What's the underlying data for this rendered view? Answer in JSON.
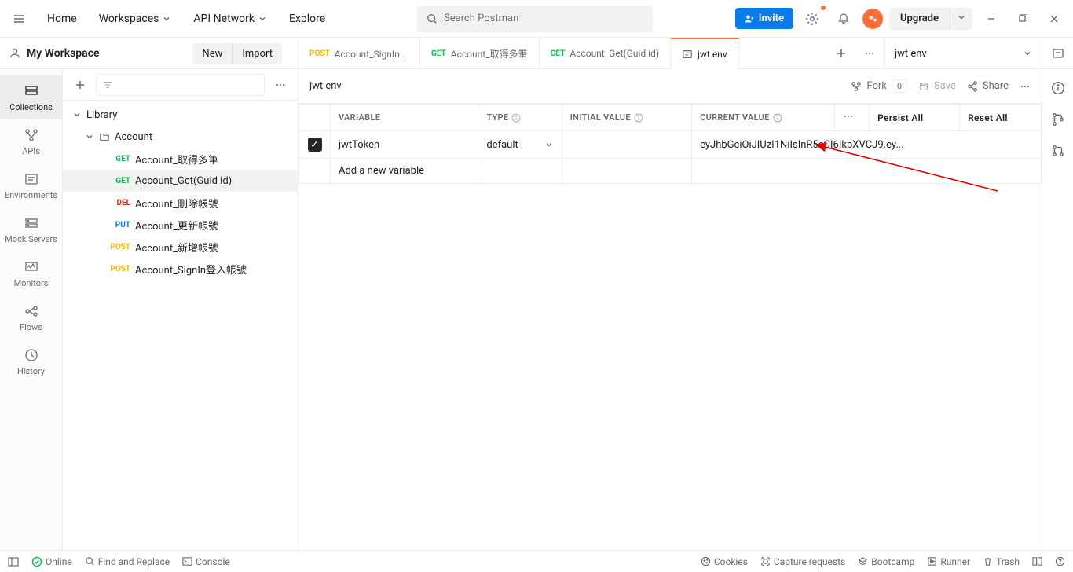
{
  "topbar": {
    "nav": {
      "home": "Home",
      "workspaces": "Workspaces",
      "api_network": "API Network",
      "explore": "Explore"
    },
    "search_placeholder": "Search Postman",
    "invite": "Invite",
    "upgrade": "Upgrade"
  },
  "workspace": {
    "name": "My Workspace",
    "new": "New",
    "import": "Import"
  },
  "rail": {
    "collections": "Collections",
    "apis": "APIs",
    "environments": "Environments",
    "mock_servers": "Mock Servers",
    "monitors": "Monitors",
    "flows": "Flows",
    "history": "History"
  },
  "tree": {
    "library": "Library",
    "account": "Account",
    "items": [
      {
        "method": "GET",
        "methodClass": "get",
        "label": "Account_取得多筆"
      },
      {
        "method": "GET",
        "methodClass": "get",
        "label": "Account_Get(Guid id)",
        "active": true
      },
      {
        "method": "DEL",
        "methodClass": "del",
        "label": "Account_刪除帳號"
      },
      {
        "method": "PUT",
        "methodClass": "put",
        "label": "Account_更新帳號"
      },
      {
        "method": "POST",
        "methodClass": "post",
        "label": "Account_新增帳號"
      },
      {
        "method": "POST",
        "methodClass": "post",
        "label": "Account_SignIn登入帳號"
      }
    ]
  },
  "tabs": [
    {
      "method": "POST",
      "methodClass": "post",
      "label": "Account_SignIn登入帳"
    },
    {
      "method": "GET",
      "methodClass": "get",
      "label": "Account_取得多筆"
    },
    {
      "method": "GET",
      "methodClass": "get",
      "label": "Account_Get(Guid id)"
    },
    {
      "icon": "env",
      "label": "jwt env",
      "active": true
    }
  ],
  "env_selector": "jwt env",
  "toolbar": {
    "title": "jwt env",
    "fork": "Fork",
    "fork_count": "0",
    "save": "Save",
    "share": "Share"
  },
  "table": {
    "headers": {
      "variable": "VARIABLE",
      "type": "TYPE",
      "initial": "INITIAL VALUE",
      "current": "CURRENT VALUE",
      "persist": "Persist All",
      "reset": "Reset All"
    },
    "rows": [
      {
        "checked": true,
        "variable": "jwtToken",
        "type": "default",
        "initial": "",
        "current": "eyJhbGciOiJIUzI1NiIsInR5cCI6IkpXVCJ9.ey..."
      }
    ],
    "add_placeholder": "Add a new variable"
  },
  "footer": {
    "online": "Online",
    "find": "Find and Replace",
    "console": "Console",
    "cookies": "Cookies",
    "capture": "Capture requests",
    "bootcamp": "Bootcamp",
    "runner": "Runner",
    "trash": "Trash"
  }
}
